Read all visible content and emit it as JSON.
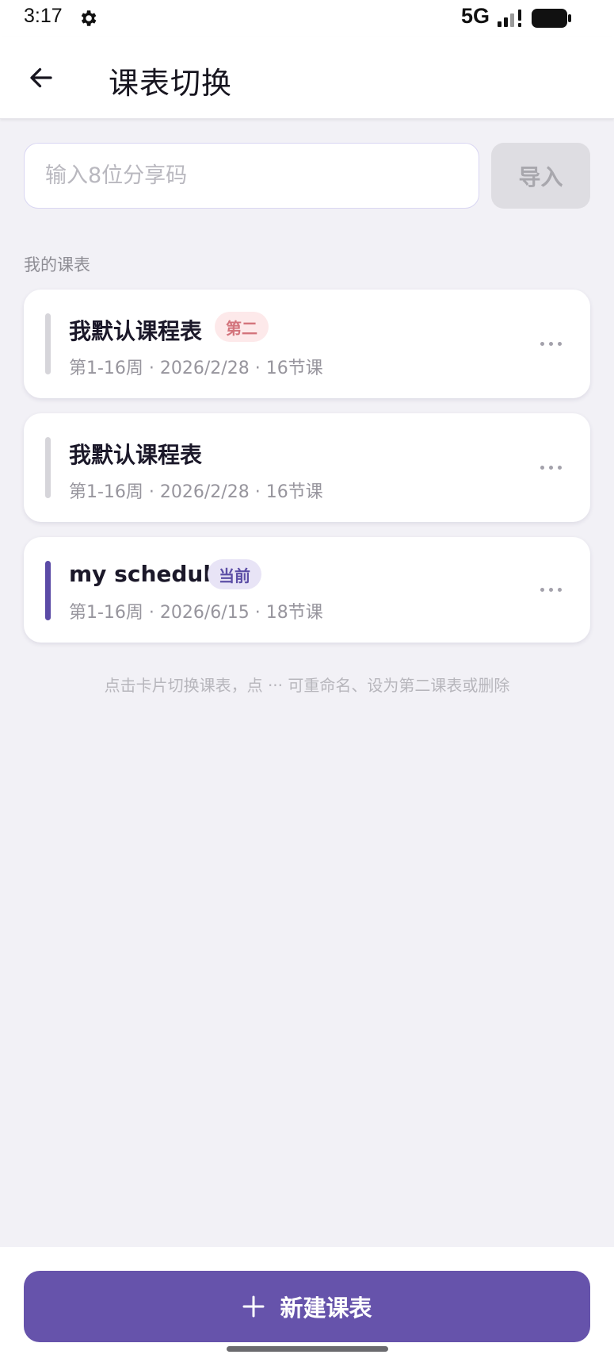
{
  "status_bar": {
    "time": "3:17",
    "network": "5G",
    "icons": [
      "gear-icon",
      "signal-icon",
      "battery-icon"
    ]
  },
  "header": {
    "title": "课表切换",
    "back_icon": "arrow-left-icon"
  },
  "import": {
    "placeholder": "输入8位分享码",
    "value": "",
    "button_label": "导入"
  },
  "section_label": "我的课表",
  "schedules": [
    {
      "name": "我默认课程表",
      "badge": "第二",
      "meta": "第1-16周 · 2026/2/28 · 16节课",
      "accent": "#d6d5da"
    },
    {
      "name": "我默认课程表",
      "badge": "",
      "meta": "第1-16周 · 2026/2/28 · 16节课",
      "accent": "#d6d5da"
    },
    {
      "name": "my schedule",
      "badge": "当前",
      "meta": "第1-16周 · 2026/6/15 · 18节课",
      "accent": "#5b4ba6"
    }
  ],
  "hint": "点击卡片切换课表，点 ··· 可重命名、设为第二课表或删除",
  "new_button": {
    "label": "新建课表",
    "icon": "plus-icon"
  },
  "colors": {
    "primary": "#6653ab",
    "background": "#f2f1f6",
    "badge_second": "#d3747c",
    "badge_current": "#5c4ea6"
  }
}
